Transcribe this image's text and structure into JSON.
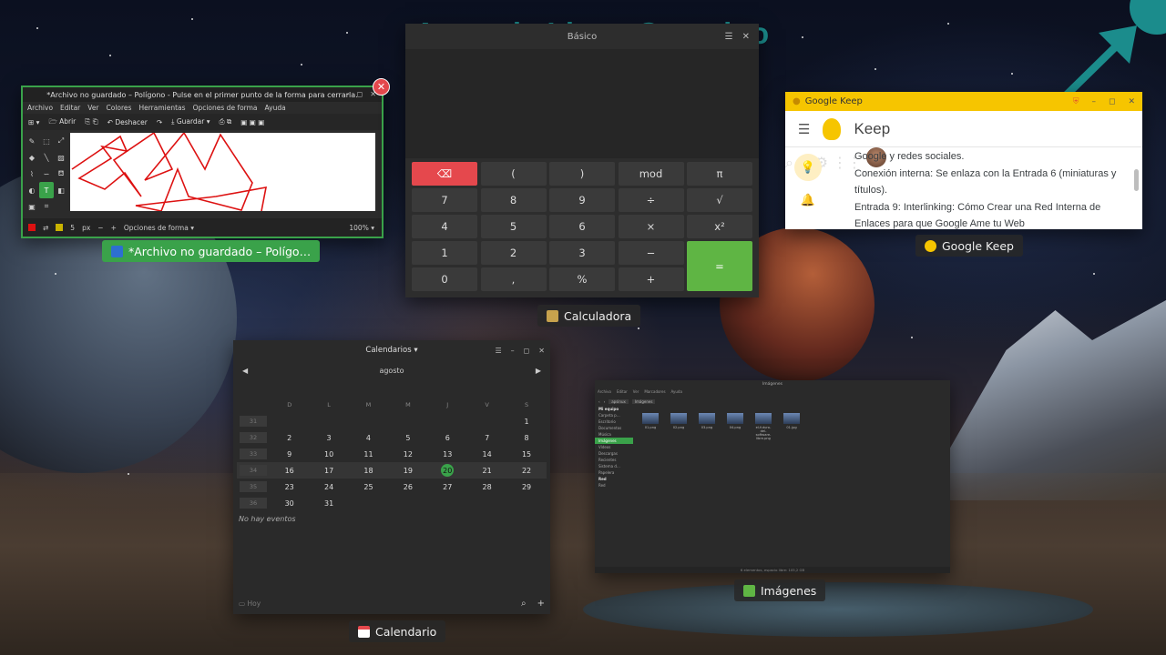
{
  "banner": {
    "text": "Aprende Linux Conmigo"
  },
  "colors": {
    "accent_green": "#3aa24a",
    "banner_teal": "#1b8c8c",
    "delete_red": "#e5484d",
    "keep_yellow": "#f6c500"
  },
  "drawing": {
    "title": "*Archivo no guardado – Polígono - Pulse en el primer punto de la forma para cerrarla.",
    "window_controls": [
      "–",
      "◻",
      "✕"
    ],
    "menu": [
      "Archivo",
      "Editar",
      "Ver",
      "Colores",
      "Herramientas",
      "Opciones de forma",
      "Ayuda"
    ],
    "toolbar": {
      "open": "Abrir",
      "undo": "Deshacer",
      "save": "Guardar"
    },
    "size_value": "5",
    "size_unit": "px",
    "shape_options": "Opciones de forma",
    "zoom": "100%",
    "chip_label": "*Archivo no guardado – Polígo…",
    "close_badge": "✕"
  },
  "calculator": {
    "title": "Básico",
    "menu_icon": "☰",
    "close": "✕",
    "keys": [
      "⌫",
      "(",
      ")",
      "mod",
      "π",
      "7",
      "8",
      "9",
      "÷",
      "√",
      "4",
      "5",
      "6",
      "×",
      "x²",
      "1",
      "2",
      "3",
      "−",
      "=",
      "0",
      ",",
      "%",
      "+"
    ],
    "chip_label": "Calculadora"
  },
  "keep": {
    "window_title": "Google Keep",
    "app_name": "Keep",
    "window_controls": [
      "–",
      "◻",
      "✕"
    ],
    "content_lines": [
      "Google y redes sociales.",
      "Conexión interna: Se enlaza con la Entrada 6 (miniaturas y",
      "títulos).",
      "Entrada 9: Interlinking: Cómo Crear una Red Interna de",
      "Enlaces para que Google Ame tu Web"
    ],
    "chip_label": "Google Keep"
  },
  "calendar": {
    "title": "Calendarios",
    "month": "agosto",
    "weekdays": [
      "D",
      "L",
      "M",
      "M",
      "J",
      "V",
      "S"
    ],
    "weeks": [
      {
        "wk": "31",
        "days": [
          "",
          "",
          "",
          "",
          "",
          "",
          "1"
        ]
      },
      {
        "wk": "32",
        "days": [
          "2",
          "3",
          "4",
          "5",
          "6",
          "7",
          "8"
        ]
      },
      {
        "wk": "33",
        "days": [
          "9",
          "10",
          "11",
          "12",
          "13",
          "14",
          "15"
        ]
      },
      {
        "wk": "34",
        "days": [
          "16",
          "17",
          "18",
          "19",
          "20",
          "21",
          "22"
        ]
      },
      {
        "wk": "35",
        "days": [
          "23",
          "24",
          "25",
          "26",
          "27",
          "28",
          "29"
        ]
      },
      {
        "wk": "36",
        "days": [
          "30",
          "31",
          "",
          "",
          "",
          "",
          ""
        ]
      }
    ],
    "today": "20",
    "no_events": "No hay eventos",
    "today_button": "Hoy",
    "chip_label": "Calendario"
  },
  "files": {
    "title": "Imágenes",
    "menu": [
      "Archivo",
      "Editar",
      "Ver",
      "Marcadores",
      "Ayuda"
    ],
    "path": [
      "apsinux",
      "Imágenes"
    ],
    "sidebar": [
      "Mi equipo",
      "Carpeta p…",
      "Escritorio",
      "Documentos",
      "Música",
      "Imágenes",
      "Vídeos",
      "Descargas",
      "Recientes",
      "Sistema d…",
      "Papelera",
      "Red",
      "Red"
    ],
    "items": [
      "01.png",
      "02.png",
      "03.png",
      "04.png",
      "el-futuro-del-software-libre.png",
      "01.jpg"
    ],
    "status": "6 elementos, espacio libre: 105,2 GB",
    "chip_label": "Imágenes"
  }
}
